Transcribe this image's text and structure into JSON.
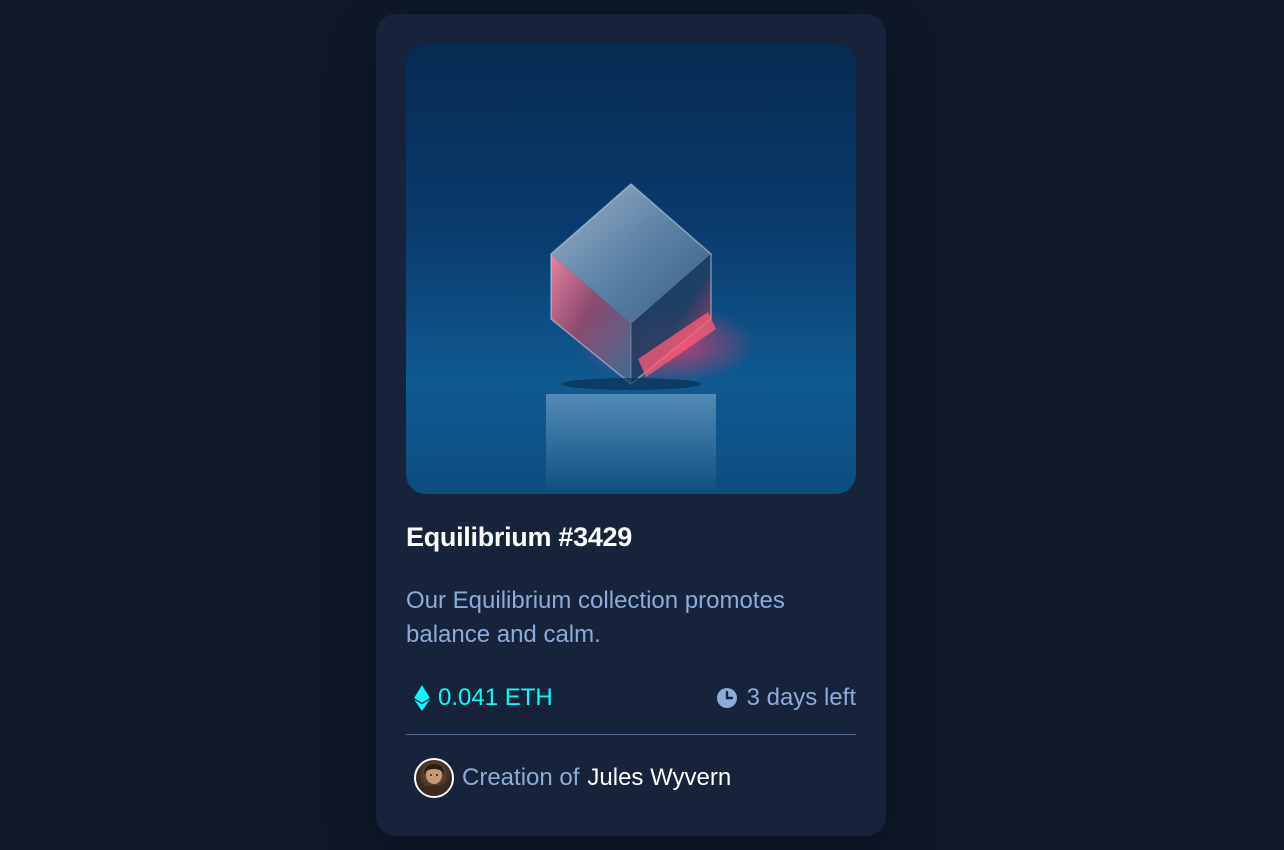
{
  "card": {
    "image_alt": "Equilibrium image",
    "title": "Equilibrium #3429",
    "description": "Our Equilibrium collection promotes balance and calm.",
    "price": "0.041 ETH",
    "time_left": "3 days left",
    "creator_prefix": "Creation of",
    "creator_name": "Jules Wyvern"
  },
  "icons": {
    "price": "ethereum-icon",
    "time": "clock-icon"
  },
  "colors": {
    "page_bg": "#0e1829",
    "card_bg": "#16233b",
    "accent_cyan": "#00fff8",
    "soft_blue": "#8bacda",
    "white": "#ffffff",
    "divider": "#52698f"
  }
}
